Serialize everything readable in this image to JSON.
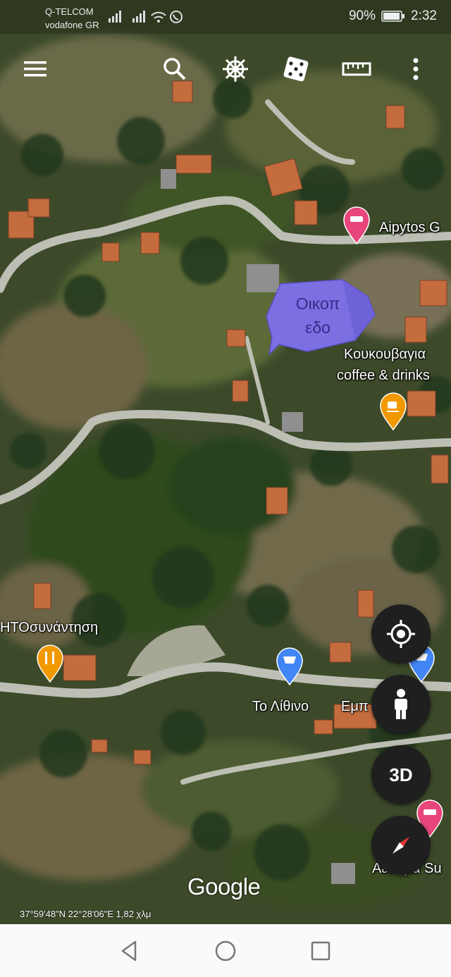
{
  "status_bar": {
    "carrier_1": "Q-TELCOM",
    "carrier_2": "vodafone GR",
    "battery": "90%",
    "time": "2:32"
  },
  "toolbar": {
    "icons": [
      "menu-icon",
      "search-icon",
      "voyager-wheel-icon",
      "dice-icon",
      "ruler-icon",
      "more-vertical-icon"
    ]
  },
  "map": {
    "type": "satellite",
    "places": [
      {
        "name": "Aipytos G",
        "category": "hotel",
        "pin_color": "#e8457a"
      },
      {
        "name": "Κουκουβαγια coffee & drinks",
        "line1": "Κουκουβαγια",
        "line2": "coffee & drinks",
        "category": "cafe",
        "pin_color": "#f29900"
      },
      {
        "name": "ΗΤΟσυνάντηση",
        "category": "restaurant",
        "pin_color": "#f29900"
      },
      {
        "name": "Το Λίθινο",
        "category": "shop",
        "pin_color": "#4285f4"
      },
      {
        "name": "Εμπ",
        "category": "shop",
        "pin_color": "#4285f4"
      },
      {
        "name": "Αετώμα Su",
        "category": "hotel",
        "pin_color": "#e8457a"
      }
    ],
    "annotation": {
      "line1": "Οικοπ",
      "line2": "εδο",
      "color": "#7a6ee0"
    },
    "coordinates": "37°59'48\"N 22°28'06\"E 1,82 χλμ",
    "logo": "Google"
  },
  "controls": {
    "my_location": "my-location-icon",
    "street_view": "pegman-icon",
    "three_d_label": "3D",
    "compass": "compass-icon"
  },
  "nav_bar": {
    "icons": [
      "back-icon",
      "home-icon",
      "recents-icon"
    ]
  }
}
